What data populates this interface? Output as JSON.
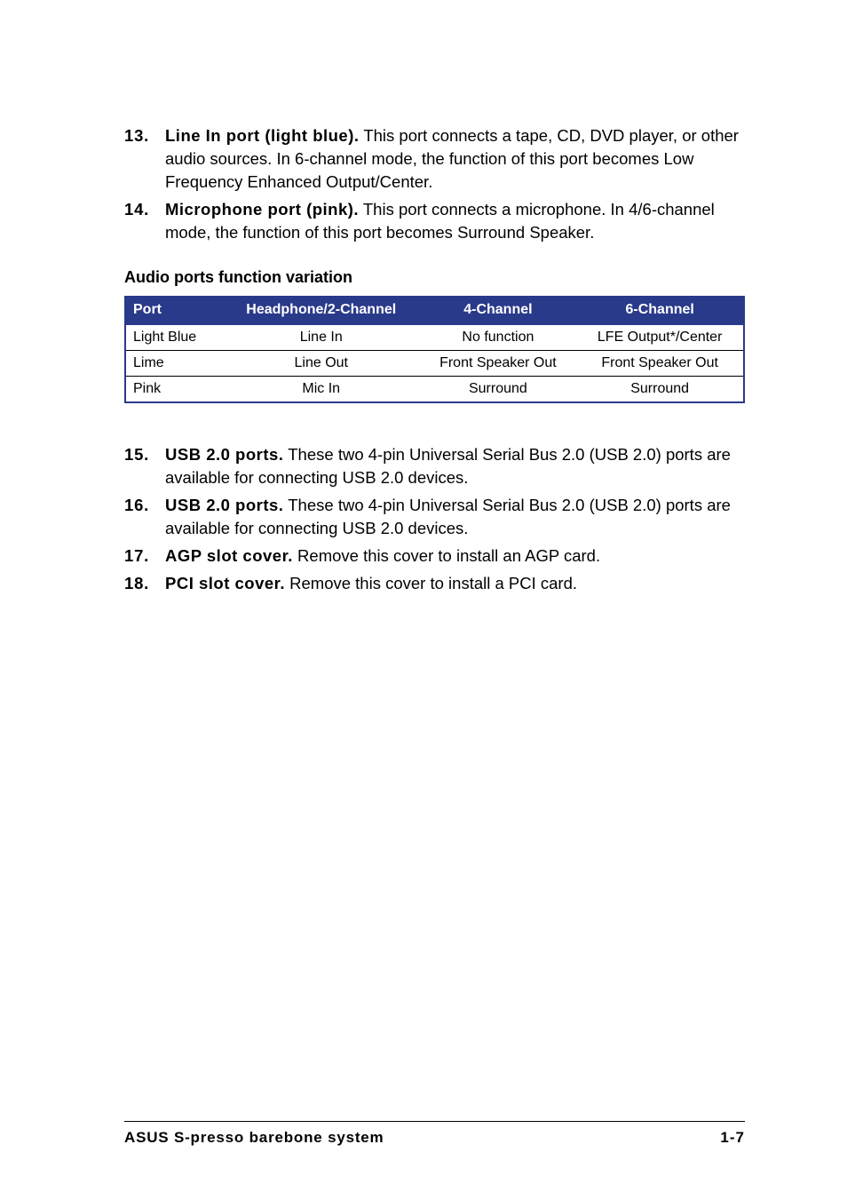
{
  "items_top": [
    {
      "num": "13.",
      "label": "Line In port (light blue).",
      "text": " This port connects a tape, CD, DVD player, or other audio sources. In 6-channel mode, the function of this port becomes Low Frequency Enhanced Output/Center."
    },
    {
      "num": "14.",
      "label": "Microphone port (pink).",
      "text": " This port connects a microphone. In 4/6-channel mode, the function of this port becomes Surround Speaker."
    }
  ],
  "table_heading": "Audio ports function variation",
  "table": {
    "headers": [
      "Port",
      "Headphone/2-Channel",
      "4-Channel",
      "6-Channel"
    ],
    "rows": [
      [
        "Light Blue",
        "Line In",
        "No function",
        "LFE Output*/Center"
      ],
      [
        "Lime",
        "Line Out",
        "Front Speaker Out",
        "Front Speaker Out"
      ],
      [
        "Pink",
        "Mic In",
        "Surround",
        "Surround"
      ]
    ]
  },
  "items_bottom": [
    {
      "num": "15.",
      "label": "USB 2.0 ports.",
      "text": " These two 4-pin Universal Serial Bus 2.0 (USB 2.0) ports are available for connecting USB 2.0 devices."
    },
    {
      "num": "16.",
      "label": "USB 2.0 ports.",
      "text": " These two 4-pin Universal Serial Bus 2.0 (USB 2.0) ports are available for connecting USB 2.0 devices."
    },
    {
      "num": "17.",
      "label": "AGP slot cover.",
      "text": " Remove this cover to install an AGP card."
    },
    {
      "num": "18.",
      "label": "PCI slot cover.",
      "text": " Remove this cover to install a PCI card."
    }
  ],
  "footer": {
    "left": "ASUS S-presso barebone system",
    "right": "1-7"
  }
}
